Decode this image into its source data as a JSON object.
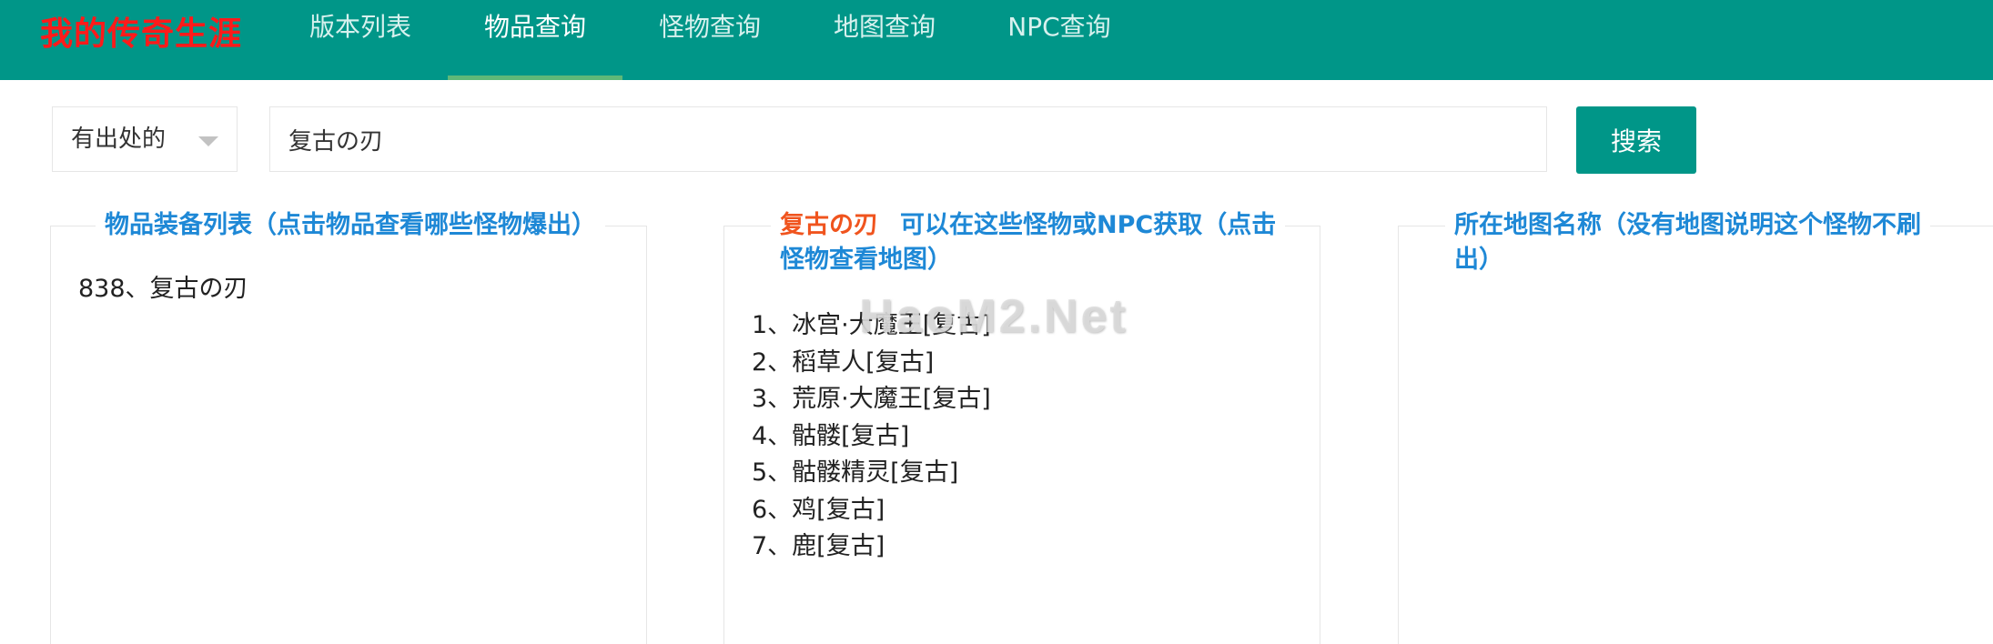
{
  "header": {
    "brand": "我的传奇生涯",
    "nav": [
      {
        "label": "版本列表",
        "active": false
      },
      {
        "label": "物品查询",
        "active": true
      },
      {
        "label": "怪物查询",
        "active": false
      },
      {
        "label": "地图查询",
        "active": false
      },
      {
        "label": "NPC查询",
        "active": false
      }
    ]
  },
  "search": {
    "filter_selected": "有出处的",
    "query": "复古の刃",
    "button_label": "搜索"
  },
  "panels": {
    "items": {
      "title": "物品装备列表（点击物品查看哪些怪物爆出）",
      "entries": [
        "838、复古の刃"
      ]
    },
    "sources": {
      "item_name": "复古の刃",
      "title_line1": "可以在这些怪物或NPC获取（点击",
      "title_line2": "怪物查看地图）",
      "entries": [
        "1、冰宫·大魔王[复古]",
        "2、稻草人[复古]",
        "3、荒原·大魔王[复古]",
        "4、骷髅[复古]",
        "5、骷髅精灵[复古]",
        "6、鸡[复古]",
        "7、鹿[复古]"
      ]
    },
    "maps": {
      "title_line1": "所在地图名称（没有地图说明这个怪物不刷",
      "title_line2": "出）"
    }
  },
  "watermark": "HaoM2.Net",
  "colors": {
    "header_bg": "#009688",
    "brand": "#ff1a1a",
    "nav_active_underline": "#5FB878",
    "panel_title": "#1e88d6",
    "item_name_highlight": "#f0541e"
  }
}
